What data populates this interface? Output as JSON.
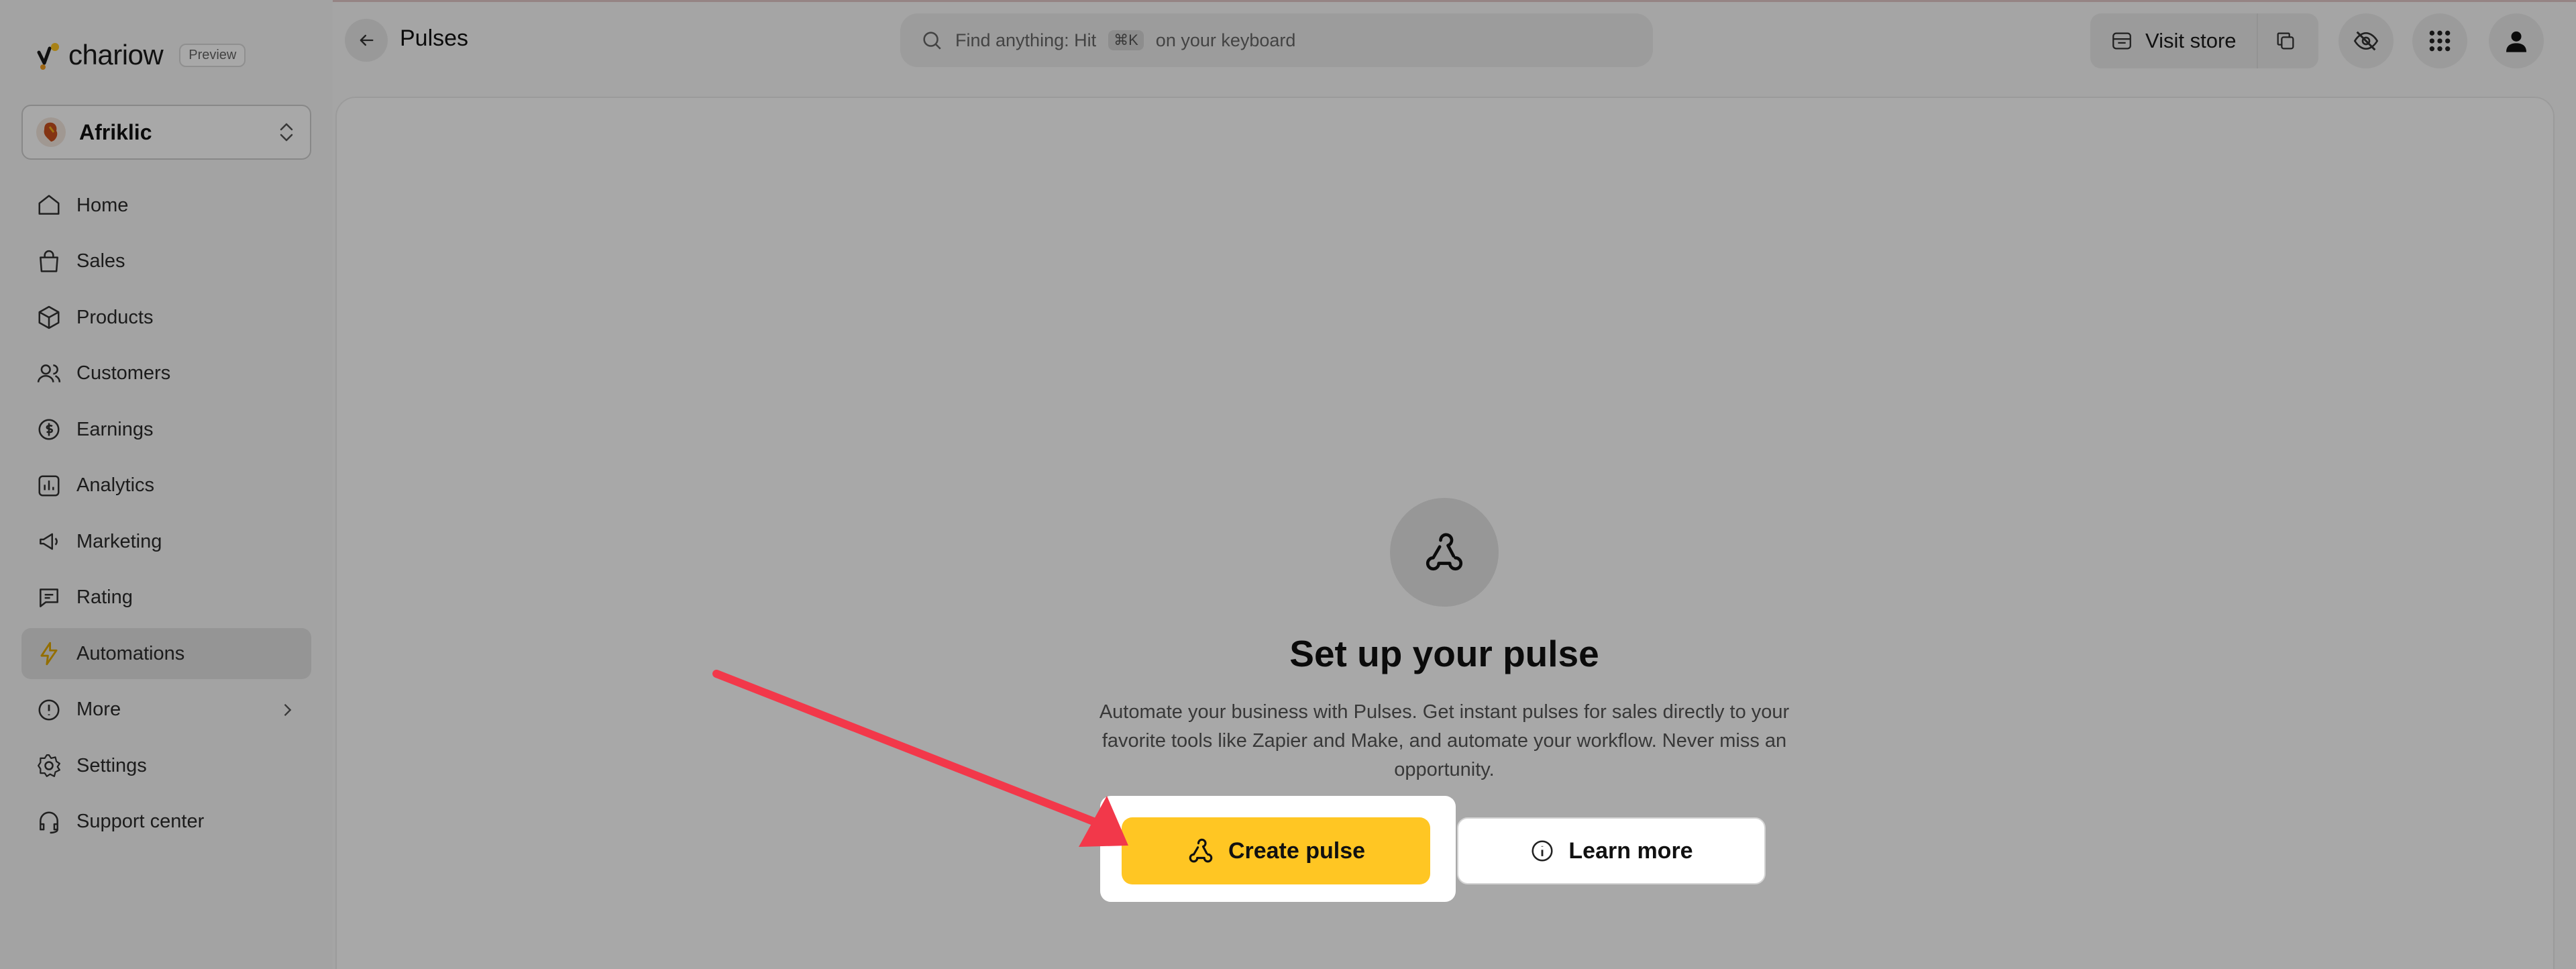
{
  "app": {
    "name": "chariow",
    "badge": "Preview"
  },
  "store": {
    "name": "Afriklic"
  },
  "sidebar": {
    "items": [
      {
        "label": "Home",
        "icon": "home-icon"
      },
      {
        "label": "Sales",
        "icon": "shopping-bag-icon"
      },
      {
        "label": "Products",
        "icon": "box-icon"
      },
      {
        "label": "Customers",
        "icon": "users-icon"
      },
      {
        "label": "Earnings",
        "icon": "dollar-circle-icon"
      },
      {
        "label": "Analytics",
        "icon": "bar-chart-icon"
      },
      {
        "label": "Marketing",
        "icon": "megaphone-icon"
      },
      {
        "label": "Rating",
        "icon": "message-star-icon"
      },
      {
        "label": "Automations",
        "icon": "lightning-icon",
        "active": true
      },
      {
        "label": "More",
        "icon": "info-circle-icon"
      },
      {
        "label": "Settings",
        "icon": "gear-icon"
      },
      {
        "label": "Support center",
        "icon": "headset-icon"
      }
    ]
  },
  "header": {
    "title": "Pulses",
    "search": {
      "prefix": "Find anything: Hit",
      "shortcut": "⌘K",
      "suffix": "on your keyboard"
    },
    "visit_store": "Visit store"
  },
  "empty_state": {
    "title": "Set up your pulse",
    "description": "Automate your business with Pulses. Get instant pulses for sales directly to your favorite tools like Zapier and Make, and automate your workflow. Never miss an opportunity.",
    "primary_action": "Create pulse",
    "secondary_action": "Learn more"
  },
  "colors": {
    "accent": "#ffc623",
    "arrow": "#f2384a",
    "active_nav": "#e3e3e3"
  }
}
